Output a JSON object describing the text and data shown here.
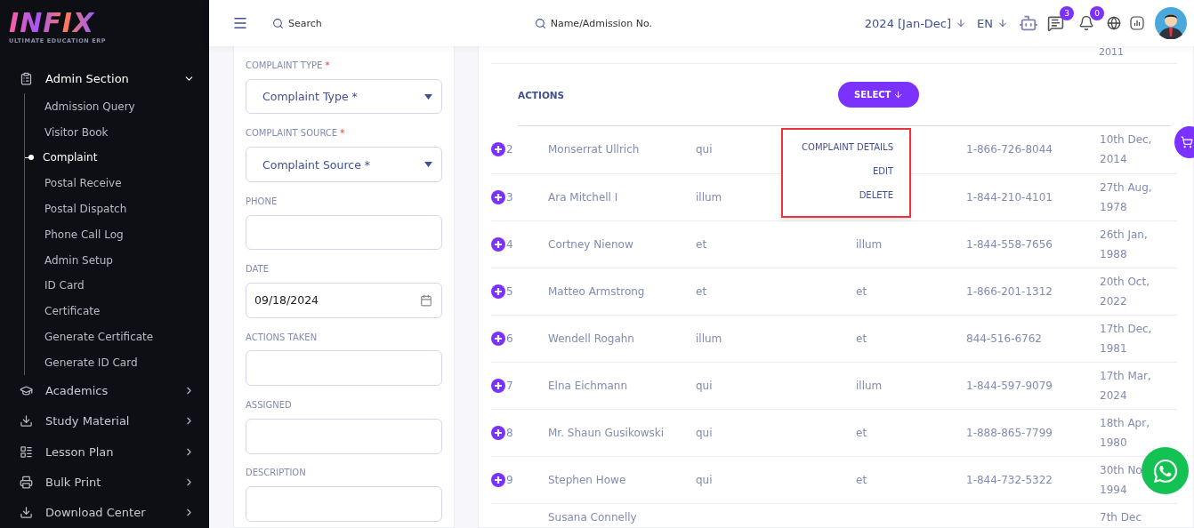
{
  "logo": {
    "name": "INFIX",
    "tagline": "ULTIMATE EDUCATION ERP"
  },
  "sidebar": {
    "items": [
      {
        "label": "Admin Section",
        "expanded": true,
        "children": [
          {
            "label": "Admission Query",
            "selected": false
          },
          {
            "label": "Visitor Book",
            "selected": false
          },
          {
            "label": "Complaint",
            "selected": true
          },
          {
            "label": "Postal Receive",
            "selected": false
          },
          {
            "label": "Postal Dispatch",
            "selected": false
          },
          {
            "label": "Phone Call Log",
            "selected": false
          },
          {
            "label": "Admin Setup",
            "selected": false
          },
          {
            "label": "ID Card",
            "selected": false
          },
          {
            "label": "Certificate",
            "selected": false
          },
          {
            "label": "Generate Certificate",
            "selected": false
          },
          {
            "label": "Generate ID Card",
            "selected": false
          }
        ]
      },
      {
        "label": "Academics",
        "expanded": false
      },
      {
        "label": "Study Material",
        "expanded": false
      },
      {
        "label": "Lesson Plan",
        "expanded": false
      },
      {
        "label": "Bulk Print",
        "expanded": false
      },
      {
        "label": "Download Center",
        "expanded": false
      }
    ]
  },
  "header": {
    "search": "Search",
    "student_search": "Name/Admission No.",
    "session": "2024 [Jan-Dec]",
    "language": "EN",
    "messages_count": "3",
    "notifications_count": "0"
  },
  "form": {
    "fields": [
      {
        "kind": "select",
        "label": "COMPLAINT TYPE",
        "mark": "*",
        "placeholder": "Complaint Type *"
      },
      {
        "kind": "select",
        "label": "COMPLAINT SOURCE",
        "mark": "*",
        "placeholder": "Complaint Source *"
      },
      {
        "kind": "text",
        "label": "PHONE"
      },
      {
        "kind": "date",
        "label": "DATE",
        "value": "09/18/2024"
      },
      {
        "kind": "text",
        "label": "ACTIONS TAKEN"
      },
      {
        "kind": "text",
        "label": "ASSIGNED"
      },
      {
        "kind": "text",
        "label": "DESCRIPTION"
      }
    ]
  },
  "table": {
    "top_fragment": "2011",
    "actions_label": "ACTIONS",
    "select_button": "SELECT",
    "menu": [
      "COMPLAINT DETAILS",
      "EDIT",
      "DELETE"
    ],
    "rows": [
      {
        "no": "2",
        "name": "Monserrat Ullrich",
        "column_3": "qui",
        "column_4": "",
        "phone": "1-866-726-8044",
        "date": "10th Dec, 2014"
      },
      {
        "no": "3",
        "name": "Ara Mitchell I",
        "column_3": "illum",
        "column_4": "",
        "phone": "1-844-210-4101",
        "date": "27th Aug, 1978"
      },
      {
        "no": "4",
        "name": "Cortney Nienow",
        "column_3": "et",
        "column_4": "illum",
        "phone": "1-844-558-7656",
        "date": "26th Jan, 1988"
      },
      {
        "no": "5",
        "name": "Matteo Armstrong",
        "column_3": "et",
        "column_4": "et",
        "phone": "1-866-201-1312",
        "date": "20th Oct, 2022"
      },
      {
        "no": "6",
        "name": "Wendell Rogahn",
        "column_3": "illum",
        "column_4": "et",
        "phone": "844-516-6762",
        "date": "17th Dec, 1981"
      },
      {
        "no": "7",
        "name": "Elna Eichmann",
        "column_3": "qui",
        "column_4": "illum",
        "phone": "1-844-597-9079",
        "date": "17th Mar, 2024"
      },
      {
        "no": "8",
        "name": "Mr. Shaun Gusikowski",
        "column_3": "qui",
        "column_4": "et",
        "phone": "1-888-865-7799",
        "date": "18th Apr, 1980"
      },
      {
        "no": "9",
        "name": "Stephen Howe",
        "column_3": "qui",
        "column_4": "et",
        "phone": "1-844-732-5322",
        "date": "30th No 1994"
      }
    ],
    "last_row": {
      "name": "Susana Connelly",
      "date": "7th Dec"
    }
  }
}
